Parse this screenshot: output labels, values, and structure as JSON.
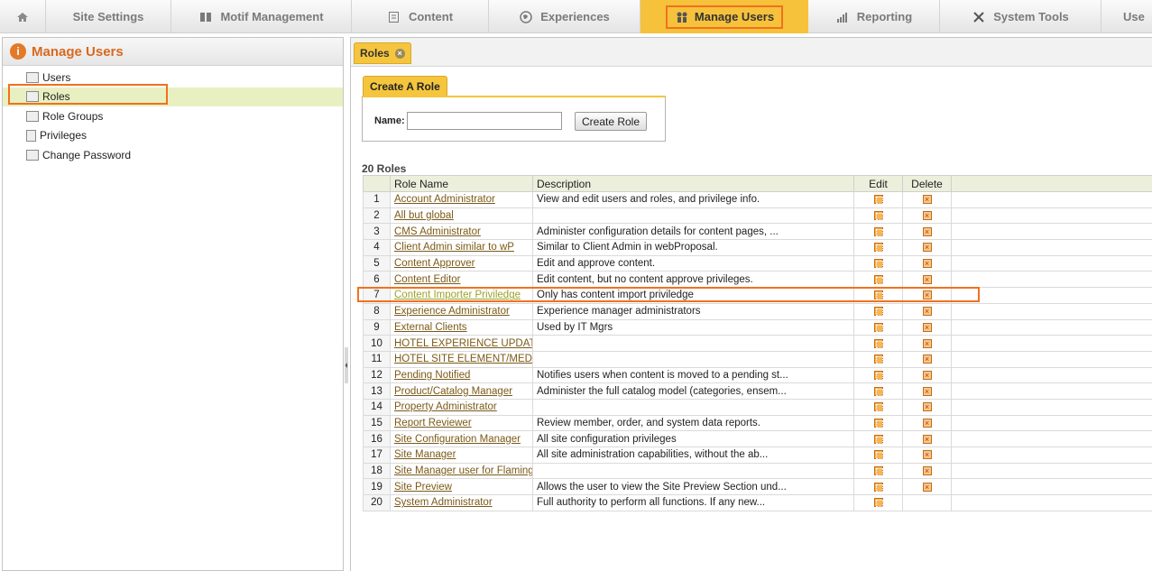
{
  "topnav": {
    "items": [
      {
        "label": ""
      },
      {
        "label": "Site Settings"
      },
      {
        "label": "Motif Management"
      },
      {
        "label": "Content"
      },
      {
        "label": "Experiences"
      },
      {
        "label": "Manage Users"
      },
      {
        "label": "Reporting"
      },
      {
        "label": "System Tools"
      },
      {
        "label": "Use"
      }
    ]
  },
  "sidebar": {
    "title": "Manage Users",
    "items": [
      {
        "label": "Users"
      },
      {
        "label": "Roles"
      },
      {
        "label": "Role Groups"
      },
      {
        "label": "Privileges"
      },
      {
        "label": "Change Password"
      }
    ]
  },
  "main": {
    "tab_label": "Roles",
    "create_title": "Create A Role",
    "name_label": "Name:",
    "name_value": "",
    "create_button": "Create Role",
    "count_label": "20 Roles",
    "columns": [
      "",
      "Role Name",
      "Description",
      "Edit",
      "Delete"
    ],
    "rows": [
      {
        "n": "1",
        "name": "Account Administrator",
        "desc": "View and edit users and roles, and privilege info.",
        "del": true
      },
      {
        "n": "2",
        "name": "All but global",
        "desc": "",
        "del": true
      },
      {
        "n": "3",
        "name": "CMS Administrator",
        "desc": "Administer configuration details for content pages, ...",
        "del": true
      },
      {
        "n": "4",
        "name": "Client Admin similar to wP",
        "desc": "Similar to Client Admin in webProposal.",
        "del": true
      },
      {
        "n": "5",
        "name": "Content Approver",
        "desc": "Edit and approve content.",
        "del": true
      },
      {
        "n": "6",
        "name": "Content Editor",
        "desc": "Edit content, but no content approve privileges.",
        "del": true
      },
      {
        "n": "7",
        "name": "Content Importer Priviledge",
        "desc": "Only has content import priviledge",
        "del": true
      },
      {
        "n": "8",
        "name": "Experience Administrator",
        "desc": "Experience manager administrators",
        "del": true
      },
      {
        "n": "9",
        "name": "External Clients",
        "desc": "Used by IT Mgrs",
        "del": true
      },
      {
        "n": "10",
        "name": "HOTEL EXPERIENCE UPDATE",
        "desc": "",
        "del": true
      },
      {
        "n": "11",
        "name": "HOTEL SITE ELEMENT/MEDIAS",
        "desc": "",
        "del": true
      },
      {
        "n": "12",
        "name": "Pending Notified",
        "desc": "Notifies users when content is moved to a pending st...",
        "del": true
      },
      {
        "n": "13",
        "name": "Product/Catalog Manager",
        "desc": "Administer the full catalog model (categories, ensem...",
        "del": true
      },
      {
        "n": "14",
        "name": "Property Administrator",
        "desc": "",
        "del": true
      },
      {
        "n": "15",
        "name": "Report Reviewer",
        "desc": "Review member, order, and system data reports.",
        "del": true
      },
      {
        "n": "16",
        "name": "Site Configuration Manager",
        "desc": "All site configuration privileges",
        "del": true
      },
      {
        "n": "17",
        "name": "Site Manager",
        "desc": "All site administration capabilities, without the ab...",
        "del": true
      },
      {
        "n": "18",
        "name": "Site Manager user for Flamingo",
        "desc": "",
        "del": true
      },
      {
        "n": "19",
        "name": "Site Preview",
        "desc": "Allows the user to view the Site Preview Section und...",
        "del": true
      },
      {
        "n": "20",
        "name": "System Administrator",
        "desc": "Full authority to perform all functions. If any new...",
        "del": false
      }
    ]
  },
  "colors": {
    "accent": "#f0711f",
    "tab": "#f5c63d",
    "title": "#d8691f"
  }
}
